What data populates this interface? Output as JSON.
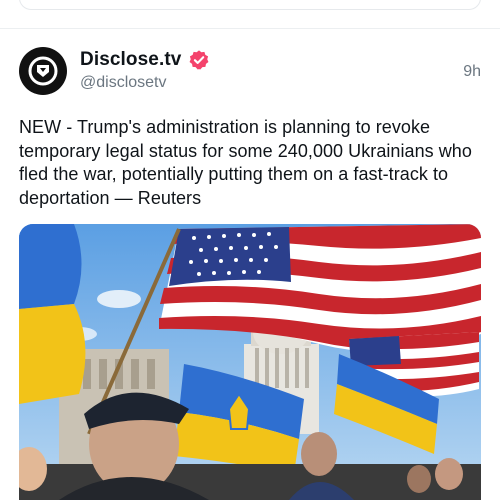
{
  "post": {
    "display_name": "Disclose.tv",
    "handle": "@disclosetv",
    "time": "9h",
    "text": "NEW - Trump's administration is planning to revoke temporary legal status for some 240,000 Ukrainians who fled the war, potentially putting them on a fast-track to deportation — Reuters",
    "verified_icon": "verified-badge-icon",
    "avatar_icon": "disclose-logo-icon"
  },
  "colors": {
    "verified_badge": "#f4436c",
    "handle_gray": "#6b7680",
    "text": "#0f1419"
  },
  "media": {
    "description_icon": "photo",
    "subjects": [
      "american-flag",
      "ukrainian-flag",
      "capitol-dome"
    ]
  }
}
